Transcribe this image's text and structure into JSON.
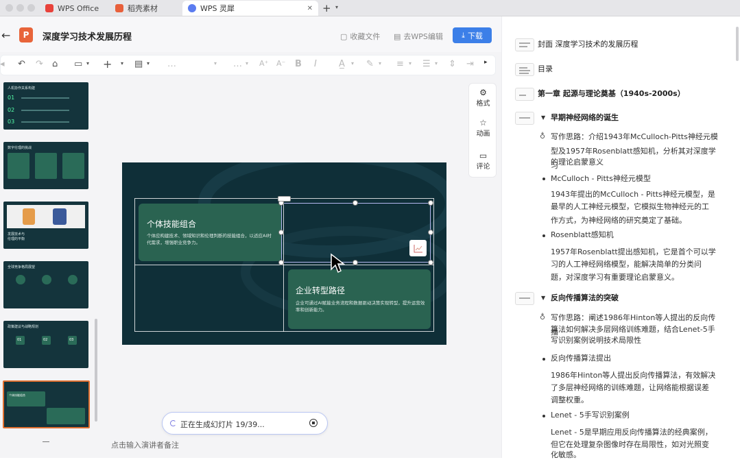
{
  "tabs": [
    {
      "label": "WPS Office"
    },
    {
      "label": "稻壳素材"
    },
    {
      "label": "WPS 灵犀"
    }
  ],
  "header": {
    "title": "深度学习技术发展历程",
    "favorite": "收藏文件",
    "edit_in_wps": "去WPS编辑",
    "download": "下载"
  },
  "toolbar": {
    "ellipsis": "…",
    "ellipsis2": "…",
    "bold": "B",
    "italic": "I"
  },
  "slide": {
    "card1": {
      "title": "个体技能组合",
      "body": "个体应构建技术、领域知识和伦理判断的技能组合，以适应AI时代需求，增强职业竞争力。"
    },
    "card2": {
      "title": "企业转型路径",
      "body": "企业可通过AI赋能业务流程和数据驱动决策实现转型，提升运营效率和创新能力。"
    }
  },
  "thumbnails": [
    {
      "title": "人机协作关系构建",
      "items": [
        "01",
        "02",
        "03"
      ]
    },
    {
      "title": "数字伦理的挑战"
    },
    {
      "title": "发展技术与伦理的平衡"
    },
    {
      "title": "全球竞争格局展望"
    },
    {
      "title": "政策建议与战略规划",
      "items": [
        "01",
        "02",
        "03"
      ]
    },
    {
      "title": "个体技能组合"
    }
  ],
  "side_panel": {
    "format": "格式",
    "animation": "动画",
    "comment": "评论"
  },
  "generation": {
    "status": "正在生成幻灯片 19/39..."
  },
  "notes": {
    "placeholder": "点击输入演讲者备注"
  },
  "outline": {
    "cover": "封面 深度学习技术的发展历程",
    "toc": "目录",
    "chapter1": "第一章 起源与理论奠基（1940s-2000s）",
    "s1": {
      "title": "早期神经网络的诞生",
      "hint": [
        "写作思路：介绍1943年McCulloch-Pitts神经元模",
        "型及1957年Rosenblatt感知机，分析其对深度学习",
        "的理论启蒙意义"
      ],
      "b1": "McCulloch - Pitts神经元模型",
      "b1text": [
        "1943年提出的McCulloch - Pitts神经元模型，是",
        "最早的人工神经元模型，它模拟生物神经元的工",
        "作方式，为神经网络的研究奠定了基础。"
      ],
      "b2": "Rosenblatt感知机",
      "b2text": [
        "1957年Rosenblatt提出感知机，它是首个可以学",
        "习的人工神经网络模型，能解决简单的分类问",
        "题，对深度学习有重要理论启蒙意义。"
      ]
    },
    "s2": {
      "title": "反向传播算法的突破",
      "hint": [
        "写作思路：阐述1986年Hinton等人提出的反向传播",
        "算法如何解决多层网络训练难题，结合Lenet-5手",
        "写识别案例说明技术局限性"
      ],
      "b1": "反向传播算法提出",
      "b1text": [
        "1986年Hinton等人提出反向传播算法，有效解决",
        "了多层神经网络的训练难题，让网络能根据误差",
        "调整权重。"
      ],
      "b2": "Lenet - 5手写识别案例",
      "b2text": [
        "Lenet - 5是早期应用反向传播算法的经典案例，",
        "但它在处理复杂图像时存在局限性，如对光照变",
        "化敏感。"
      ]
    }
  },
  "colors": {
    "accent": "#3c7fe8",
    "slide_bg": "#0f2f38",
    "card": "#2a6351"
  }
}
